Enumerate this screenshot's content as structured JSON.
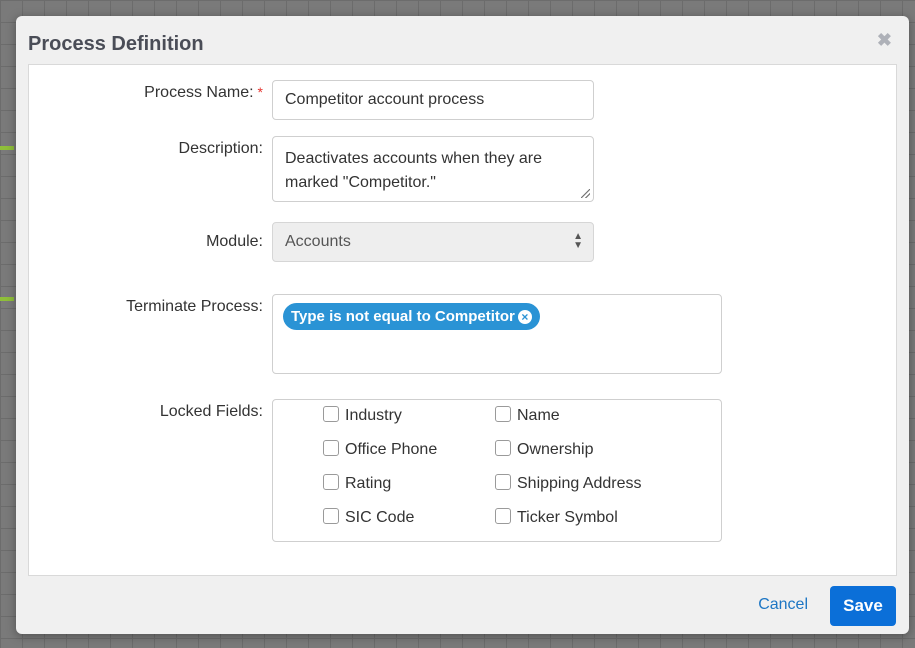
{
  "modal": {
    "title": "Process Definition",
    "close_icon": "close-icon"
  },
  "form": {
    "process_name": {
      "label": "Process Name:",
      "required_marker": "*",
      "value": "Competitor account process"
    },
    "description": {
      "label": "Description:",
      "value": "Deactivates accounts when they are marked \"Competitor.\""
    },
    "module": {
      "label": "Module:",
      "selected": "Accounts"
    },
    "terminate_process": {
      "label": "Terminate Process:",
      "tags": [
        "Type is not equal to Competitor"
      ]
    },
    "locked_fields": {
      "label": "Locked Fields:",
      "options": [
        "Industry",
        "Name",
        "Office Phone",
        "Ownership",
        "Rating",
        "Shipping Address",
        "SIC Code",
        "Ticker Symbol"
      ]
    }
  },
  "footer": {
    "cancel_label": "Cancel",
    "save_label": "Save"
  },
  "colors": {
    "primary": "#0b6fd8",
    "tag": "#2a93d5",
    "required": "#e5322d"
  }
}
